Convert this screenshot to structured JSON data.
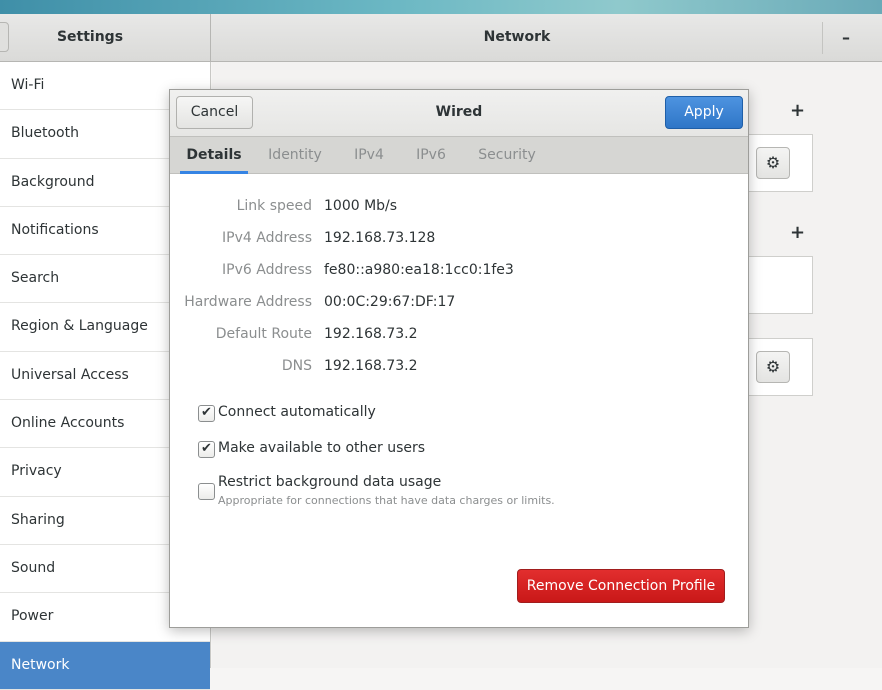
{
  "header": {
    "left_title": "Settings",
    "right_title": "Network",
    "minimize_glyph": "–"
  },
  "sidebar": {
    "items": [
      {
        "label": "Wi-Fi"
      },
      {
        "label": "Bluetooth"
      },
      {
        "label": "Background"
      },
      {
        "label": "Notifications"
      },
      {
        "label": "Search"
      },
      {
        "label": "Region & Language"
      },
      {
        "label": "Universal Access"
      },
      {
        "label": "Online Accounts"
      },
      {
        "label": "Privacy"
      },
      {
        "label": "Sharing"
      },
      {
        "label": "Sound"
      },
      {
        "label": "Power"
      },
      {
        "label": "Network"
      }
    ],
    "active_item": "Network"
  },
  "main": {
    "plus_glyph": "+",
    "gear_glyph": "⚙"
  },
  "dialog": {
    "title": "Wired",
    "cancel_label": "Cancel",
    "apply_label": "Apply",
    "tabs": [
      {
        "label": "Details",
        "active": true
      },
      {
        "label": "Identity",
        "active": false
      },
      {
        "label": "IPv4",
        "active": false
      },
      {
        "label": "IPv6",
        "active": false
      },
      {
        "label": "Security",
        "active": false
      }
    ],
    "details": [
      {
        "key": "Link speed",
        "value": "1000 Mb/s"
      },
      {
        "key": "IPv4 Address",
        "value": "192.168.73.128"
      },
      {
        "key": "IPv6 Address",
        "value": "fe80::a980:ea18:1cc0:1fe3"
      },
      {
        "key": "Hardware Address",
        "value": "00:0C:29:67:DF:17"
      },
      {
        "key": "Default Route",
        "value": "192.168.73.2"
      },
      {
        "key": "DNS",
        "value": "192.168.73.2"
      }
    ],
    "options": {
      "connect_automatically": {
        "label": "Connect automatically",
        "checked": true
      },
      "available_to_others": {
        "label": "Make available to other users",
        "checked": true
      },
      "restrict_background": {
        "label": "Restrict background data usage",
        "sublabel": "Appropriate for connections that have data charges or limits.",
        "checked": false
      }
    },
    "remove_label": "Remove Connection Profile",
    "check_glyph": "✔"
  },
  "colors": {
    "accent": "#3584e4",
    "apply_bg": "#2f76c7",
    "destructive": "#d11f1f",
    "sidebar_active": "#4a86c8"
  }
}
